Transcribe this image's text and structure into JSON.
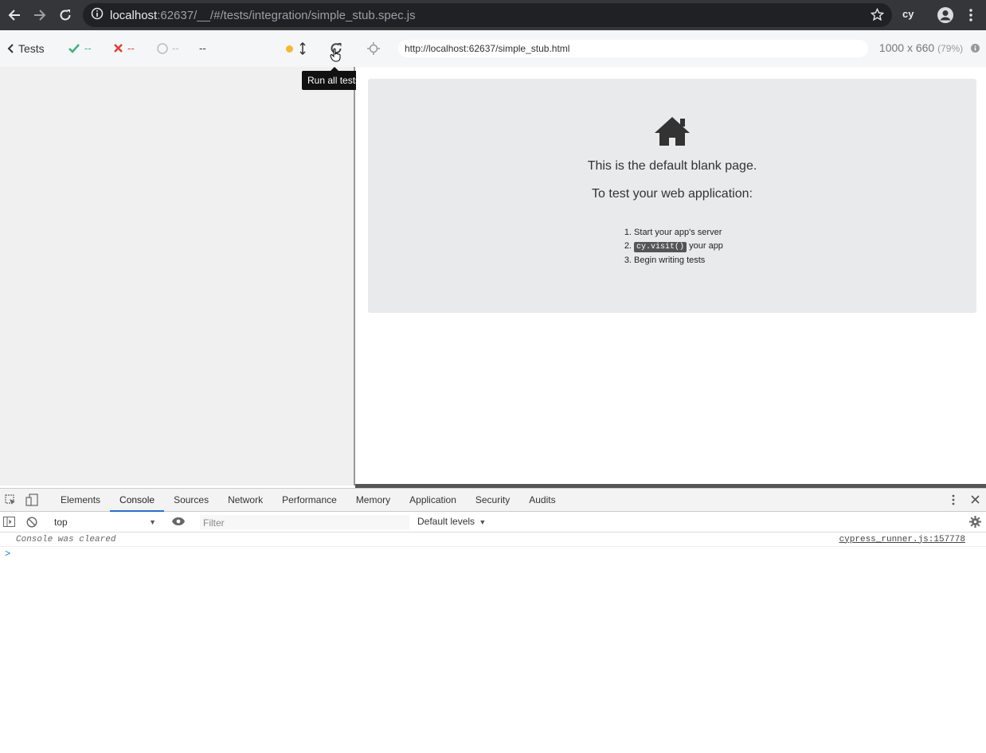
{
  "browser": {
    "url_host": "localhost",
    "url_rest": ":62637/__/#/tests/integration/simple_stub.spec.js",
    "extension_label": "cy"
  },
  "reporter": {
    "back_label": "Tests",
    "passed": "--",
    "failed": "--",
    "pending": "--",
    "duration": "--"
  },
  "tooltip": {
    "text": "Run all tests"
  },
  "runner": {
    "aut_url": "http://localhost:62637/simple_stub.html",
    "viewport": "1000 x 660",
    "scale": "(79%)"
  },
  "blank_page": {
    "line1": "This is the default blank page.",
    "line2": "To test your web application:",
    "step1": "Start your app's server",
    "step2_code": "cy.visit()",
    "step2_text": " your app",
    "step3": "Begin writing tests"
  },
  "devtools": {
    "tabs": [
      "Elements",
      "Console",
      "Sources",
      "Network",
      "Performance",
      "Memory",
      "Application",
      "Security",
      "Audits"
    ],
    "active_tab": "Console",
    "context": "top",
    "filter_placeholder": "Filter",
    "levels": "Default levels",
    "log_message": "Console was cleared",
    "log_source": "cypress_runner.js:157778",
    "prompt": ">"
  },
  "colors": {
    "pass": "#3fb27f",
    "fail": "#e43b3b",
    "running": "#f5b92b"
  }
}
